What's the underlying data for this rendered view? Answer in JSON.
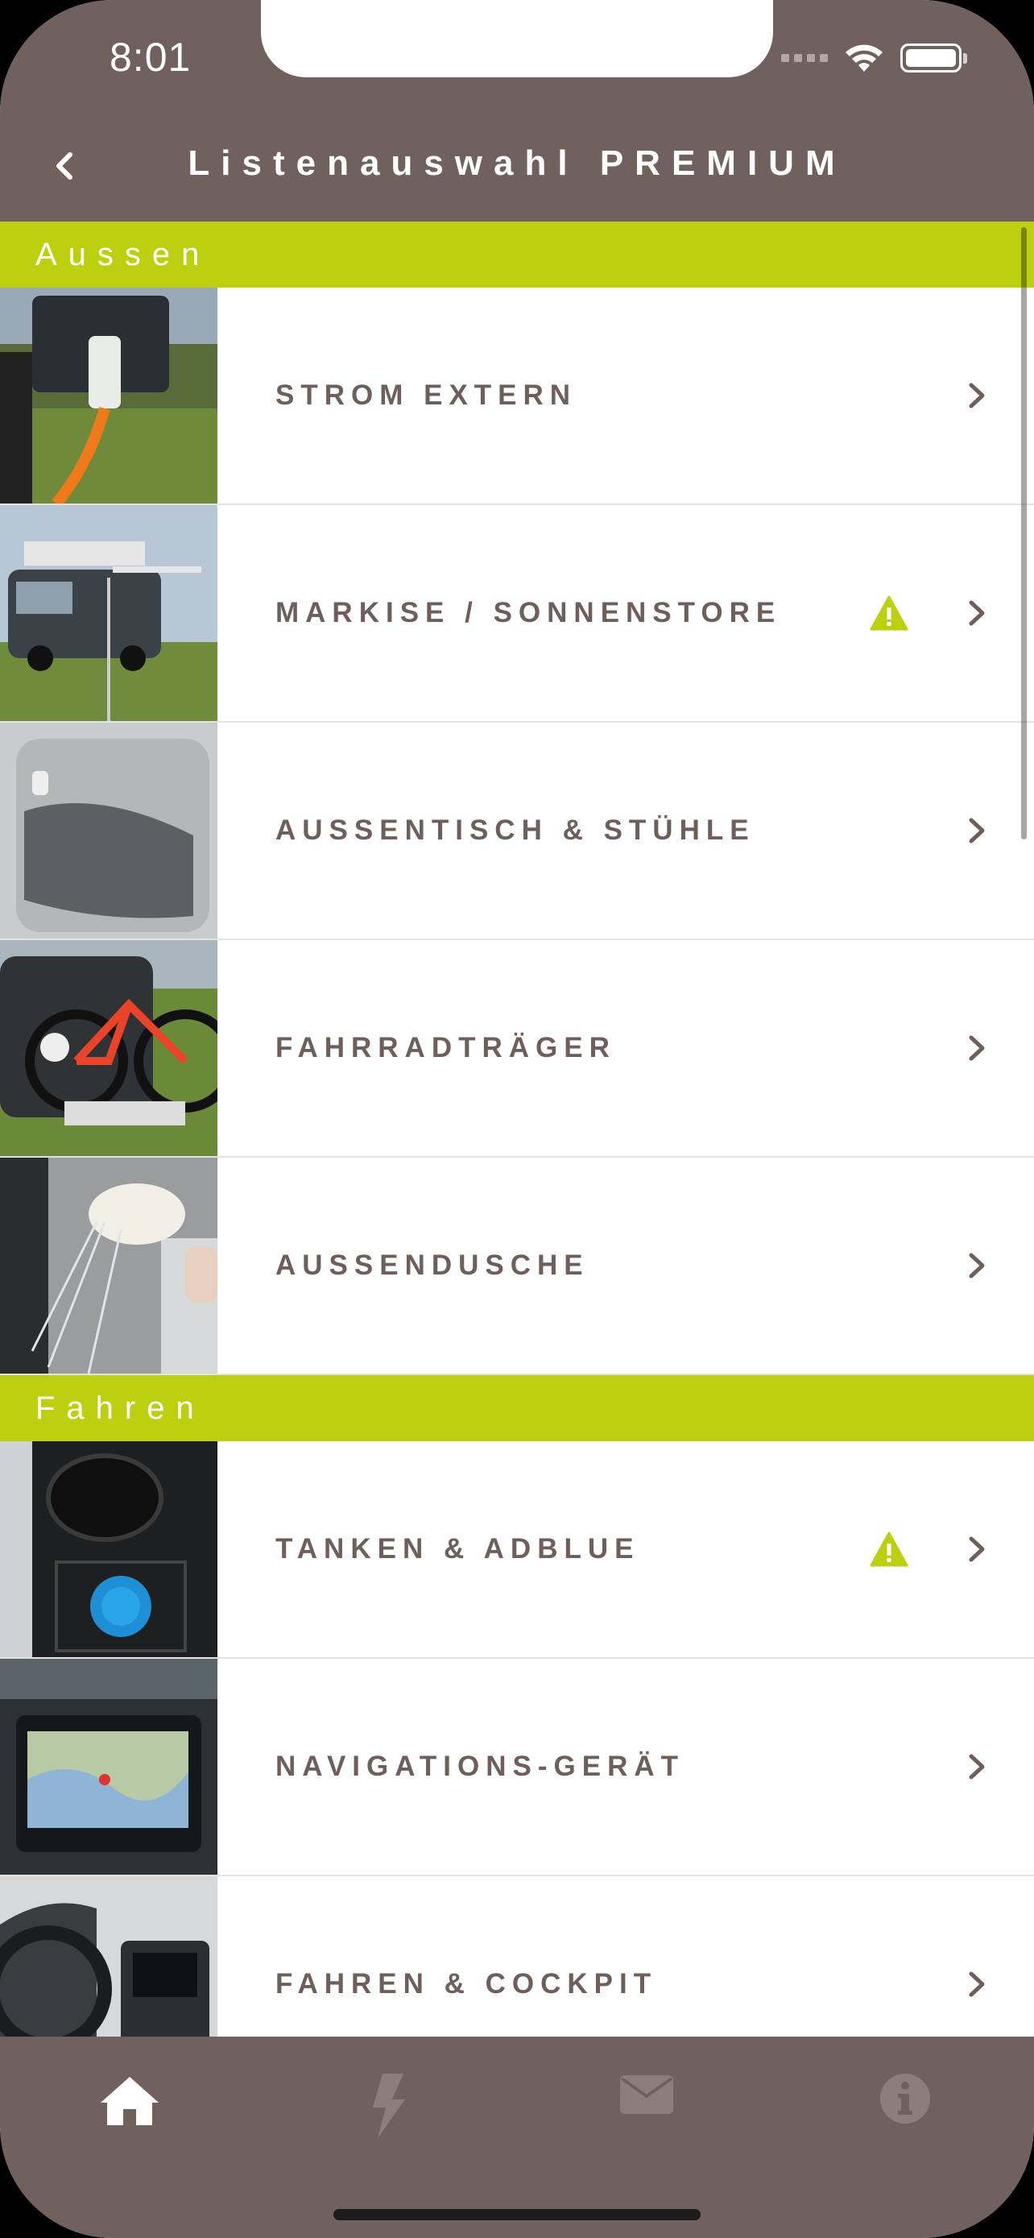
{
  "status_bar": {
    "time": "8:01"
  },
  "nav": {
    "title": "Listenauswahl PREMIUM"
  },
  "sections": [
    {
      "title": "Aussen",
      "items": [
        {
          "label": "STROM EXTERN",
          "warning": false,
          "thumb": "power-plug-photo"
        },
        {
          "label": "MARKISE / SONNENSTORE",
          "warning": true,
          "thumb": "awning-van-photo"
        },
        {
          "label": "AUSSENTISCH & STÜHLE",
          "warning": false,
          "thumb": "tailgate-table-photo"
        },
        {
          "label": "FAHRRADTRÄGER",
          "warning": false,
          "thumb": "bike-rack-photo"
        },
        {
          "label": "AUSSENDUSCHE",
          "warning": false,
          "thumb": "outdoor-shower-photo"
        }
      ]
    },
    {
      "title": "Fahren",
      "items": [
        {
          "label": "TANKEN & ADBLUE",
          "warning": true,
          "thumb": "fuel-cap-photo"
        },
        {
          "label": "NAVIGATIONS-GERÄT",
          "warning": false,
          "thumb": "navigation-screen-photo"
        },
        {
          "label": "FAHREN & COCKPIT",
          "warning": false,
          "thumb": "cockpit-photo"
        }
      ]
    }
  ],
  "tabs": [
    {
      "icon": "home-icon",
      "active": true
    },
    {
      "icon": "lightning-icon",
      "active": false
    },
    {
      "icon": "mail-icon",
      "active": false
    },
    {
      "icon": "info-icon",
      "active": false
    }
  ],
  "colors": {
    "brand_brown": "#71615e",
    "accent_lime": "#bcd010",
    "label_text": "#6f5f5c"
  }
}
